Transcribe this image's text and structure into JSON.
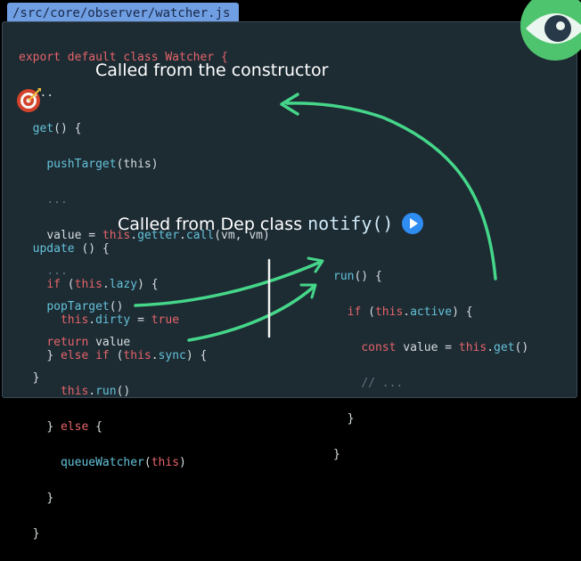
{
  "file_path": "/src/core/observer/watcher.js",
  "code": {
    "l1": "export default class Watcher {",
    "l2": "...",
    "l3_fn": "get",
    "l3_rest": "() {",
    "l4_fn": "pushTarget",
    "l4_rest": "(this)",
    "l5": "...",
    "l6_a": "value = ",
    "l6_this": "this",
    "l6_b": ".",
    "l6_fn1": "getter",
    "l6_c": ".",
    "l6_fn2": "call",
    "l6_d": "(vm, vm)",
    "l7": "...",
    "l8_fn": "popTarget",
    "l8_rest": "()",
    "l9_kw": "return",
    "l9_rest": " value",
    "l10": "}",
    "u1_fn": "update",
    "u1_rest": " () {",
    "u2_kw": "if",
    "u2_a": " (",
    "u2_this": "this",
    "u2_b": ".",
    "u2_fn": "lazy",
    "u2_c": ") {",
    "u3_this": "this",
    "u3_b": ".",
    "u3_fn": "dirty",
    "u3_c": " = ",
    "u3_kw": "true",
    "u4_a": "} ",
    "u4_kw1": "else",
    "u4_b": " ",
    "u4_kw2": "if",
    "u4_c": " (",
    "u4_this": "this",
    "u4_d": ".",
    "u4_fn": "sync",
    "u4_e": ") {",
    "u5_this": "this",
    "u5_b": ".",
    "u5_fn": "run",
    "u5_c": "()",
    "u6_a": "} ",
    "u6_kw": "else",
    "u6_b": " {",
    "u7_fn": "queueWatcher",
    "u7_a": "(",
    "u7_this": "this",
    "u7_b": ")",
    "u8": "}",
    "u9": "}",
    "r1_fn": "run",
    "r1_rest": "() {",
    "r2_kw": "if",
    "r2_a": " (",
    "r2_this": "this",
    "r2_b": ".",
    "r2_fn": "active",
    "r2_c": ") {",
    "r3_kw": "const",
    "r3_a": " value = ",
    "r3_this": "this",
    "r3_b": ".",
    "r3_fn": "get",
    "r3_c": "()",
    "r4": "// ...",
    "r5": "}",
    "r6": "}"
  },
  "annotations": {
    "constructor_note": "Called from the constructor",
    "dep_note_prefix": "Called from Dep class ",
    "dep_note_code": "notify()"
  },
  "icons": {
    "logo": "eye-logo-icon",
    "target": "target-icon",
    "play": "play-icon"
  },
  "colors": {
    "tab": "#6f9ee3",
    "panel": "#1d2b33",
    "keyword": "#e5646a",
    "function": "#64c2d9",
    "comment": "#5f7480",
    "arrow": "#45d68a"
  }
}
